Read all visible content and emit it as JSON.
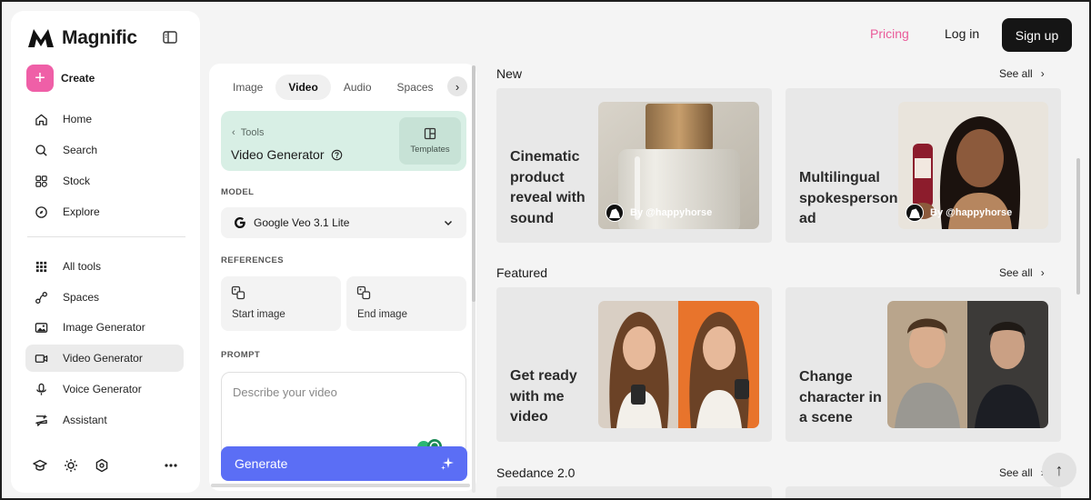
{
  "brand": {
    "name": "Magnific"
  },
  "sidebar": {
    "create_label": "Create",
    "nav": [
      {
        "label": "Home",
        "icon": "home-icon"
      },
      {
        "label": "Search",
        "icon": "search-icon"
      },
      {
        "label": "Stock",
        "icon": "stock-icon"
      },
      {
        "label": "Explore",
        "icon": "explore-icon"
      }
    ],
    "tools": [
      {
        "label": "All tools",
        "icon": "grid-icon"
      },
      {
        "label": "Spaces",
        "icon": "spaces-icon"
      },
      {
        "label": "Image Generator",
        "icon": "image-icon"
      },
      {
        "label": "Video Generator",
        "icon": "video-icon",
        "active": true
      },
      {
        "label": "Voice Generator",
        "icon": "microphone-icon"
      },
      {
        "label": "Assistant",
        "icon": "assistant-icon"
      }
    ],
    "bottom_icons": [
      "graduation-cap-icon",
      "sun-icon",
      "settings-hex-icon",
      "more-icon"
    ]
  },
  "header": {
    "pricing": "Pricing",
    "login": "Log in",
    "signup": "Sign up"
  },
  "panel": {
    "tabs": [
      "Image",
      "Video",
      "Audio",
      "Spaces"
    ],
    "active_tab": "Video",
    "back_label": "Tools",
    "tool_name": "Video Generator",
    "templates_label": "Templates",
    "model_label": "MODEL",
    "model_value": "Google Veo 3.1 Lite",
    "references_label": "REFERENCES",
    "start_image": "Start image",
    "end_image": "End image",
    "prompt_label": "PROMPT",
    "prompt_placeholder": "Describe your video",
    "generate_label": "Generate"
  },
  "content": {
    "see_all": "See all",
    "sections": [
      {
        "title": "New",
        "cards": [
          {
            "title": "Cinematic product reveal with sound",
            "credit": "By @happyhorse"
          },
          {
            "title": "Multilingual spokesperson ad",
            "credit": "By @happyhorse"
          }
        ]
      },
      {
        "title": "Featured",
        "cards": [
          {
            "title": "Get ready with me video"
          },
          {
            "title": "Change character in a scene"
          }
        ]
      },
      {
        "title": "Seedance 2.0"
      }
    ]
  },
  "colors": {
    "accent_pink": "#ef5fa7",
    "pricing_pink": "#ea5c9a",
    "generate_blue": "#5b6ef5",
    "tool_card_mint": "#d8efe5"
  }
}
